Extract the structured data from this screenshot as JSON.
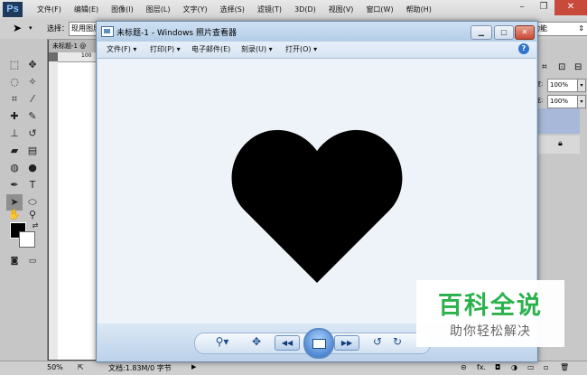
{
  "ps": {
    "logo": "Ps",
    "menu": [
      "文件(F)",
      "编辑(E)",
      "图像(I)",
      "图层(L)",
      "文字(Y)",
      "选择(S)",
      "滤镜(T)",
      "3D(D)",
      "视图(V)",
      "窗口(W)",
      "帮助(H)"
    ],
    "options": {
      "select_label": "选择：",
      "select_value": "现用图层",
      "workspace": "功能"
    },
    "doc_tab": "未标题-1 @",
    "ruler_mark": "100",
    "panels": {
      "opacity_label": "度:",
      "opacity_value": "100%",
      "fill_label": "充:",
      "fill_value": "100%"
    },
    "status": {
      "zoom": "50%",
      "doc_info": "文档:1.83M/0 字节"
    }
  },
  "photo_viewer": {
    "title": "未标题-1 - Windows 照片查看器",
    "menu": [
      "文件(F)",
      "打印(P)",
      "电子邮件(E)",
      "刻录(U)",
      "打开(O)"
    ],
    "help": "?",
    "image_subject": "black heart shape",
    "colors": {
      "heart": "#000000",
      "background": "#eef3f9"
    }
  },
  "watermark": {
    "title": "百科全说",
    "subtitle": "助你轻松解决"
  }
}
